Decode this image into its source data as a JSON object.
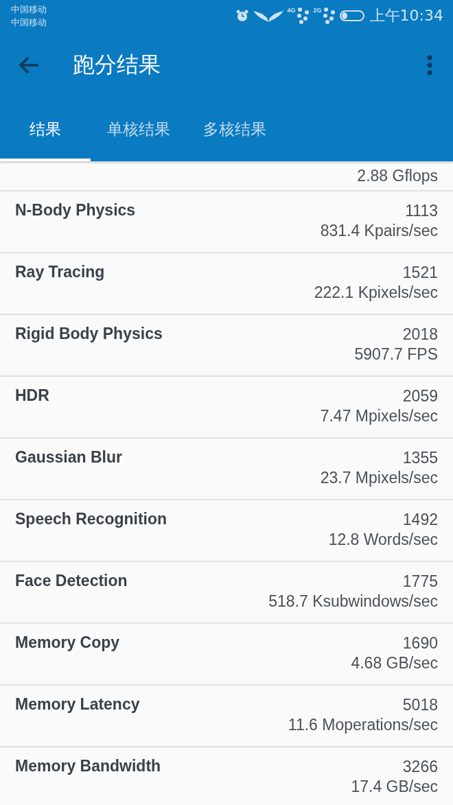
{
  "status_bar": {
    "carriers": [
      "中国移动",
      "中国移动"
    ],
    "network_labels": [
      "4G",
      "2G"
    ],
    "time": "上午10:34"
  },
  "toolbar": {
    "title": "跑分结果"
  },
  "tabs": [
    {
      "label": "结果",
      "selected": true
    },
    {
      "label": "单核结果",
      "selected": false
    },
    {
      "label": "多核结果",
      "selected": false
    }
  ],
  "partial_row": {
    "reading": "2.88 Gflops"
  },
  "results": [
    {
      "name": "N-Body Physics",
      "score": "1113",
      "reading": "831.4 Kpairs/sec"
    },
    {
      "name": "Ray Tracing",
      "score": "1521",
      "reading": "222.1 Kpixels/sec"
    },
    {
      "name": "Rigid Body Physics",
      "score": "2018",
      "reading": "5907.7 FPS"
    },
    {
      "name": "HDR",
      "score": "2059",
      "reading": "7.47 Mpixels/sec"
    },
    {
      "name": "Gaussian Blur",
      "score": "1355",
      "reading": "23.7 Mpixels/sec"
    },
    {
      "name": "Speech Recognition",
      "score": "1492",
      "reading": "12.8 Words/sec"
    },
    {
      "name": "Face Detection",
      "score": "1775",
      "reading": "518.7 Ksubwindows/sec"
    },
    {
      "name": "Memory Copy",
      "score": "1690",
      "reading": "4.68 GB/sec"
    },
    {
      "name": "Memory Latency",
      "score": "5018",
      "reading": "11.6 Moperations/sec"
    },
    {
      "name": "Memory Bandwidth",
      "score": "3266",
      "reading": "17.4 GB/sec"
    }
  ]
}
